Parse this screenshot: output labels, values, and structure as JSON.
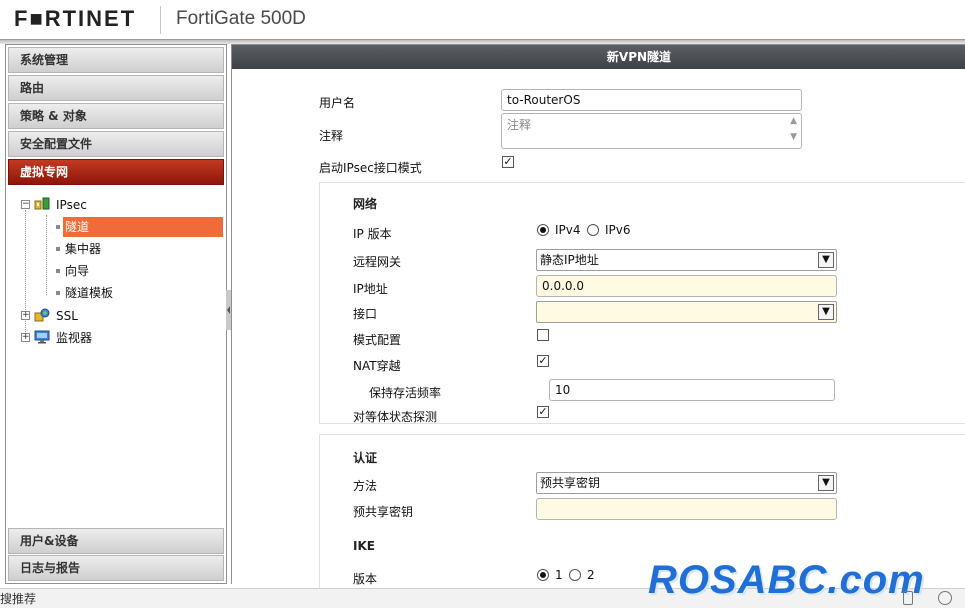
{
  "header": {
    "logo": "F■RTINET",
    "device": "FortiGate 500D"
  },
  "sidebar": {
    "items": [
      {
        "label": "系统管理"
      },
      {
        "label": "路由"
      },
      {
        "label": "策略 & 对象"
      },
      {
        "label": "安全配置文件"
      },
      {
        "label": "虚拟专网",
        "active": true
      }
    ],
    "bottom_items": [
      {
        "label": "用户&设备"
      },
      {
        "label": "日志与报告"
      }
    ],
    "tree": {
      "ipsec": {
        "label": "IPsec",
        "children": [
          {
            "label": "隧道",
            "selected": true
          },
          {
            "label": "集中器"
          },
          {
            "label": "向导"
          },
          {
            "label": "隧道模板"
          }
        ]
      },
      "ssl": {
        "label": "SSL"
      },
      "monitor": {
        "label": "监视器"
      }
    }
  },
  "main": {
    "title": "新VPN隧道",
    "name": {
      "label": "用户名",
      "value": "to-RouterOS"
    },
    "comment": {
      "label": "注释",
      "placeholder": "注释"
    },
    "ipsec_mode": {
      "label": "启动IPsec接口模式",
      "checked": true
    },
    "network": {
      "title": "网络",
      "ip_version": {
        "label": "IP 版本",
        "opt1": "IPv4",
        "opt2": "IPv6",
        "selected": "IPv4"
      },
      "remote_gw": {
        "label": "远程网关",
        "value": "静态IP地址"
      },
      "ip": {
        "label": "IP地址",
        "value": "0.0.0.0"
      },
      "interface": {
        "label": "接口",
        "value": ""
      },
      "mode_config": {
        "label": "模式配置",
        "checked": false
      },
      "nat": {
        "label": "NAT穿越",
        "checked": true
      },
      "keepalive": {
        "label": "保持存活频率",
        "value": "10"
      },
      "dpd": {
        "label": "对等体状态探测",
        "checked": true
      }
    },
    "auth": {
      "title": "认证",
      "method": {
        "label": "方法",
        "value": "预共享密钥"
      },
      "psk": {
        "label": "预共享密钥",
        "value": ""
      }
    },
    "ike": {
      "title": "IKE",
      "version": {
        "label": "版本",
        "opt1": "1",
        "opt2": "2",
        "selected": "1"
      }
    }
  },
  "statusbar": {
    "text": "搜推荐",
    "watermark": "ROSABC.com"
  },
  "colors": {
    "active_nav": "#a8250f",
    "selected_leaf": "#ef6c3a",
    "title_bar": "#4a4d52",
    "input_yellow": "#fffbe3"
  }
}
